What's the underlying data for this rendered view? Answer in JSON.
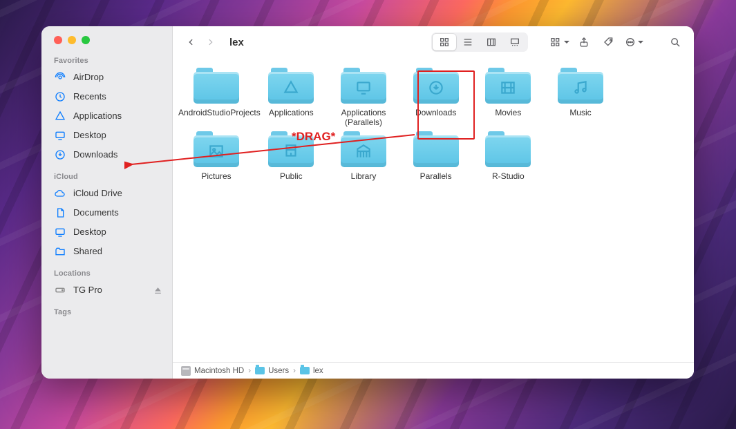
{
  "window": {
    "title": "lex"
  },
  "sidebar": {
    "favorites_label": "Favorites",
    "icloud_label": "iCloud",
    "locations_label": "Locations",
    "tags_label": "Tags",
    "favorites": [
      {
        "label": "AirDrop",
        "icon": "airdrop-icon"
      },
      {
        "label": "Recents",
        "icon": "clock-icon"
      },
      {
        "label": "Applications",
        "icon": "apps-icon"
      },
      {
        "label": "Desktop",
        "icon": "desktop-icon"
      },
      {
        "label": "Downloads",
        "icon": "download-circle-icon"
      }
    ],
    "icloud": [
      {
        "label": "iCloud Drive",
        "icon": "cloud-icon"
      },
      {
        "label": "Documents",
        "icon": "document-icon"
      },
      {
        "label": "Desktop",
        "icon": "desktop-icon"
      },
      {
        "label": "Shared",
        "icon": "shared-folder-icon"
      }
    ],
    "locations": [
      {
        "label": "TG Pro",
        "icon": "disk-icon",
        "ejectable": true
      }
    ]
  },
  "folders": [
    {
      "label": "AndroidStudioProjects",
      "sub": "",
      "glyph": "blank"
    },
    {
      "label": "Applications",
      "sub": "",
      "glyph": "apps-glyph"
    },
    {
      "label": "Applications",
      "sub": "(Parallels)",
      "glyph": "monitor-glyph"
    },
    {
      "label": "Downloads",
      "sub": "",
      "glyph": "download-glyph",
      "highlighted": true
    },
    {
      "label": "Movies",
      "sub": "",
      "glyph": "movie-glyph"
    },
    {
      "label": "Music",
      "sub": "",
      "glyph": "music-glyph"
    },
    {
      "label": "Pictures",
      "sub": "",
      "glyph": "picture-glyph"
    },
    {
      "label": "Public",
      "sub": "",
      "glyph": "public-glyph"
    },
    {
      "label": "Library",
      "sub": "",
      "glyph": "library-glyph"
    },
    {
      "label": "Parallels",
      "sub": "",
      "glyph": "blank"
    },
    {
      "label": "R-Studio",
      "sub": "",
      "glyph": "blank"
    }
  ],
  "annotation": {
    "drag_text": "*DRAG*"
  },
  "pathbar": {
    "crumbs": [
      {
        "label": "Macintosh HD",
        "icon": "disk"
      },
      {
        "label": "Users",
        "icon": "folder"
      },
      {
        "label": "lex",
        "icon": "folder"
      }
    ]
  }
}
